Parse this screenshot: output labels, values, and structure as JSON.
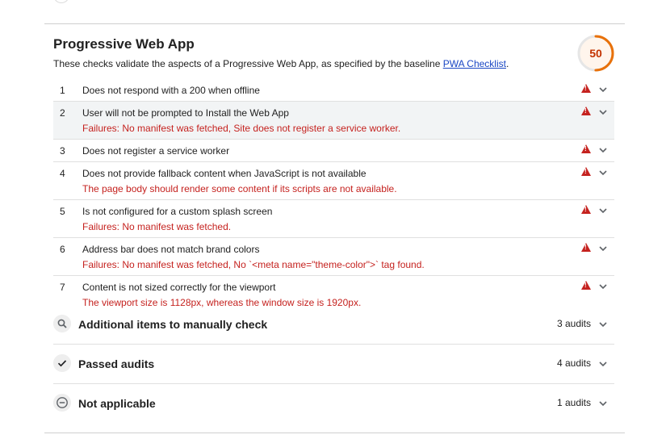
{
  "category": {
    "title": "Progressive Web App",
    "description_prefix": "These checks validate the aspects of a Progressive Web App, as specified by the baseline ",
    "link_text": "PWA Checklist",
    "description_suffix": ".",
    "score": "50",
    "score_fraction": 0.5,
    "score_color": "#e8710a"
  },
  "audits": [
    {
      "num": "1",
      "title": "Does not respond with a 200 when offline",
      "failure": ""
    },
    {
      "num": "2",
      "title": "User will not be prompted to Install the Web App",
      "failure": "Failures: No manifest was fetched, Site does not register a service worker."
    },
    {
      "num": "3",
      "title": "Does not register a service worker",
      "failure": ""
    },
    {
      "num": "4",
      "title": "Does not provide fallback content when JavaScript is not available",
      "failure": "The page body should render some content if its scripts are not available."
    },
    {
      "num": "5",
      "title": "Is not configured for a custom splash screen",
      "failure": "Failures: No manifest was fetched."
    },
    {
      "num": "6",
      "title": "Address bar does not match brand colors",
      "failure": "Failures: No manifest was fetched, No `<meta name=\"theme-color\">` tag found."
    },
    {
      "num": "7",
      "title": "Content is not sized correctly for the viewport",
      "failure": "The viewport size is 1128px, whereas the window size is 1920px."
    }
  ],
  "groups": {
    "manual": {
      "label": "Additional items to manually check",
      "count": "3 audits",
      "icon": "search-icon"
    },
    "passed": {
      "label": "Passed audits",
      "count": "4 audits",
      "icon": "check-icon"
    },
    "na": {
      "label": "Not applicable",
      "count": "1 audits",
      "icon": "minus-circle-icon"
    }
  }
}
